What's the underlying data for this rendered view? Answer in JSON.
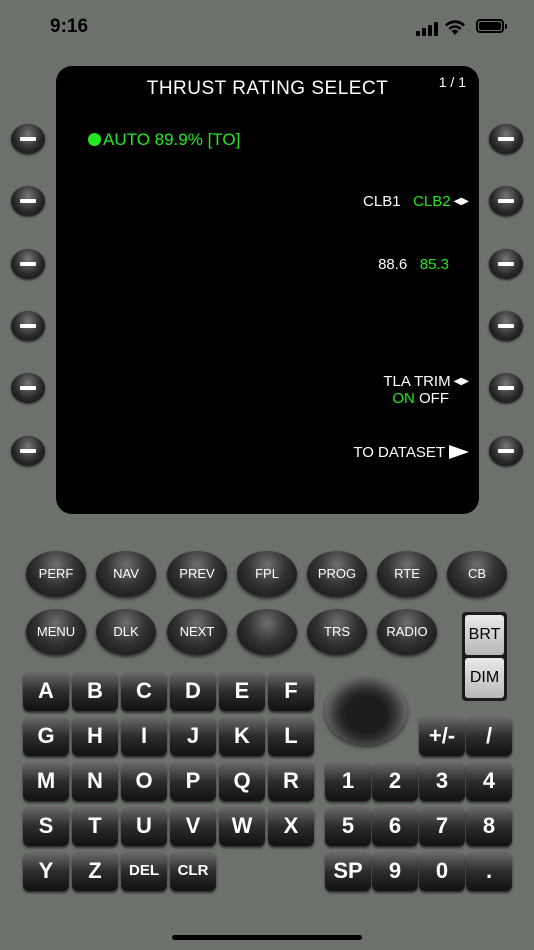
{
  "status": {
    "time": "9:16"
  },
  "screen": {
    "title": "THRUST RATING SELECT",
    "page": "1 / 1",
    "line1_left": "AUTO 89.9% [TO]",
    "clb1": "CLB1",
    "clb2": "CLB2",
    "val1": "88.6",
    "val2": "85.3",
    "tla_trim": "TLA TRIM",
    "tla_on": "ON",
    "tla_off": "OFF",
    "to_dataset": "TO DATASET"
  },
  "function_keys_row1": [
    "PERF",
    "NAV",
    "PREV",
    "FPL",
    "PROG",
    "RTE",
    "CB"
  ],
  "function_keys_row2": [
    "MENU",
    "DLK",
    "NEXT",
    "",
    "TRS",
    "RADIO"
  ],
  "brightness": {
    "brt": "BRT",
    "dim": "DIM"
  },
  "alpha_keys": [
    "A",
    "B",
    "C",
    "D",
    "E",
    "F",
    "G",
    "H",
    "I",
    "J",
    "K",
    "L",
    "M",
    "N",
    "O",
    "P",
    "Q",
    "R",
    "S",
    "T",
    "U",
    "V",
    "W",
    "X",
    "Y",
    "Z",
    "DEL",
    "CLR"
  ],
  "num_keys": [
    "+/-",
    "/",
    "1",
    "2",
    "3",
    "4",
    "5",
    "6",
    "7",
    "8",
    "SP",
    "9",
    "0",
    "."
  ],
  "colors": {
    "screen_green": "#24e81f",
    "panel": "#6c716b"
  }
}
